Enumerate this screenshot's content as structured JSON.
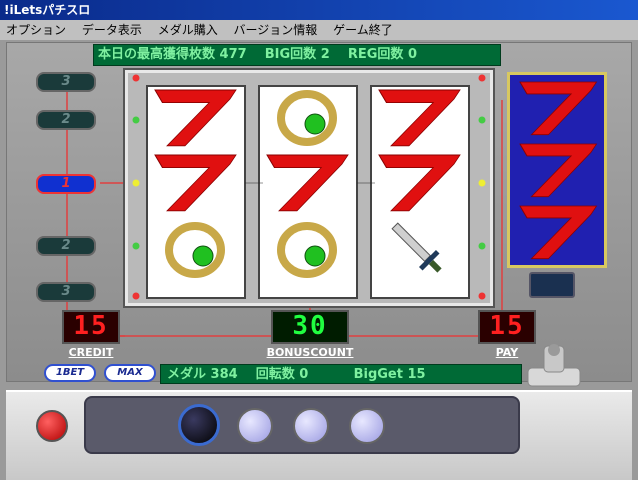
{
  "window": {
    "title": "!iLetsパチスロ"
  },
  "menu": {
    "items": [
      "オプション",
      "データ表示",
      "メダル購入",
      "バージョン情報",
      "ゲーム終了"
    ]
  },
  "top_lcd": {
    "text": "本日の最高獲得枚数 477    BIG回数 2    REG回数 0"
  },
  "bottom_lcd": {
    "text": "メダル 384    回転数 0          BigGet 15"
  },
  "side_lamps": {
    "left": [
      "3",
      "2",
      "1",
      "2",
      "3"
    ]
  },
  "counters": {
    "credit": {
      "value": "15",
      "label": "CREDIT"
    },
    "bonus": {
      "value": "30",
      "label": "BONUSCOUNT"
    },
    "pay": {
      "value": "15",
      "label": "PAY"
    }
  },
  "buttons": {
    "bet": "1BET",
    "max": "MAX"
  },
  "reels": {
    "left": [
      "seven",
      "seven",
      "bell"
    ],
    "center": [
      "bell",
      "seven",
      "bell"
    ],
    "right": [
      "seven",
      "seven",
      "sword"
    ]
  },
  "big_panel": {
    "symbols": [
      "seven",
      "seven",
      "seven"
    ]
  },
  "colors": {
    "lcd_bg": "#006a36",
    "lcd_text": "#7ff0a0",
    "seven_red": "#e01010",
    "reel_line": "#e04040"
  }
}
